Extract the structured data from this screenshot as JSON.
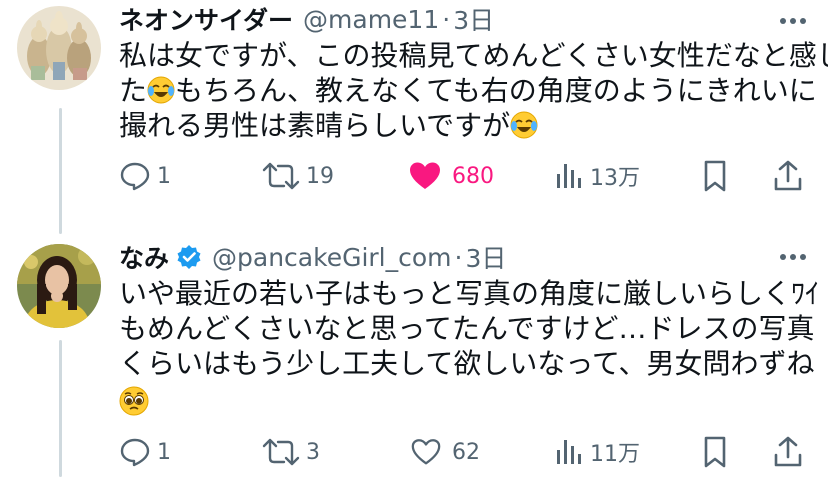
{
  "tweets": [
    {
      "display_name": "ネオンサイダー",
      "handle": "@mame11",
      "separator": "·",
      "time": "3日",
      "avatar": "illustrated-animals-avatar",
      "body_lines": [
        "私は女ですが、この投稿見てめんどくさい女性だなと感じ",
        "た",
        "もちろん、教えなくても右の角度のようにきれいに",
        "撮れる男性は素晴らしいですが"
      ],
      "emojis": [
        "face-with-tears-of-joy",
        "face-with-tears-of-joy"
      ],
      "replies": "1",
      "reposts": "19",
      "likes": "680",
      "liked": true,
      "views": "13万"
    },
    {
      "display_name": "なみ",
      "handle": "@pancakeGirl_com",
      "separator": "·",
      "time": "3日",
      "verified": true,
      "avatar": "woman-photo-avatar",
      "body_lines": [
        "いや最近の若い子はもっと写真の角度に厳しいらしくﾜｲ",
        "もめんどくさいなと思ってたんですけど…ドレスの写真",
        "くらいはもう少し工夫して欲しいなって、男女問わずね"
      ],
      "emojis": [
        "pleading-face"
      ],
      "replies": "1",
      "reposts": "3",
      "likes": "62",
      "liked": false,
      "views": "11万"
    }
  ],
  "colors": {
    "text": "#0f1419",
    "secondary": "#536471",
    "like": "#f91880",
    "verified": "#1d9bf0",
    "thread_line": "#cfd9de"
  }
}
